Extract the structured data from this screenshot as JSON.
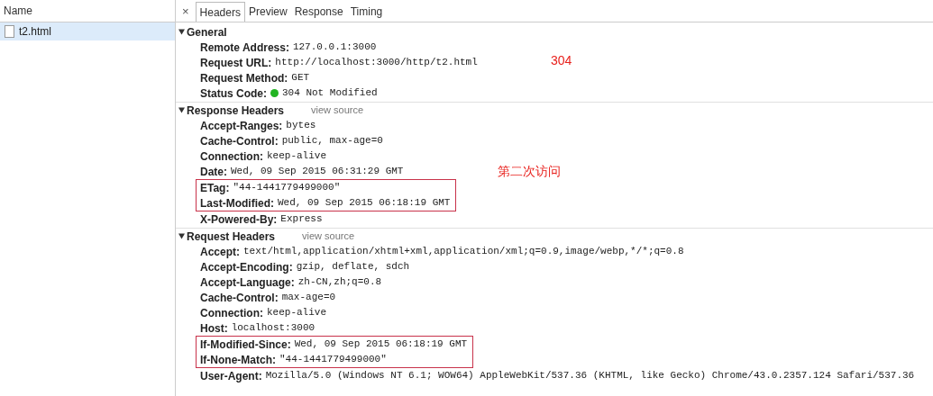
{
  "files": {
    "column": "Name",
    "items": [
      {
        "name": "t2.html",
        "selected": true
      }
    ]
  },
  "tabs": {
    "close": "×",
    "items": [
      {
        "label": "Headers",
        "selected": true
      },
      {
        "label": "Preview",
        "selected": false
      },
      {
        "label": "Response",
        "selected": false
      },
      {
        "label": "Timing",
        "selected": false
      }
    ]
  },
  "sections": [
    {
      "title": "General",
      "expanded": true,
      "note": "304",
      "rows": [
        {
          "key": "Remote Address:",
          "value": "127.0.0.1:3000",
          "highlighted": false
        },
        {
          "key": "Request URL:",
          "value": "http://localhost:3000/http/t2.html",
          "highlighted": false
        },
        {
          "key": "Request Method:",
          "value": "GET",
          "highlighted": false
        },
        {
          "key": "Status Code:",
          "value": "304 Not Modified",
          "highlighted": false,
          "color": "#22b422"
        }
      ]
    },
    {
      "title": "Response Headers",
      "expanded": true,
      "link": "view source",
      "note": "第二次访问",
      "rows": [
        {
          "key": "Accept-Ranges:",
          "value": "bytes",
          "highlighted": false
        },
        {
          "key": "Cache-Control:",
          "value": "public, max-age=0",
          "highlighted": false
        },
        {
          "key": "Connection:",
          "value": "keep-alive",
          "highlighted": false
        },
        {
          "key": "Date:",
          "value": "Wed, 09 Sep 2015 06:31:29 GMT",
          "highlighted": false
        },
        {
          "key": "ETag:",
          "value": "\"44-1441779499000\"",
          "highlighted": true
        },
        {
          "key": "Last-Modified:",
          "value": "Wed, 09 Sep 2015 06:18:19 GMT",
          "highlighted": true
        },
        {
          "key": "X-Powered-By:",
          "value": "Express",
          "highlighted": false
        }
      ]
    },
    {
      "title": "Request Headers",
      "expanded": true,
      "link": "view source",
      "rows": [
        {
          "key": "Accept:",
          "value": "text/html,application/xhtml+xml,application/xml;q=0.9,image/webp,*/*;q=0.8",
          "highlighted": false
        },
        {
          "key": "Accept-Encoding:",
          "value": "gzip, deflate, sdch",
          "highlighted": false
        },
        {
          "key": "Accept-Language:",
          "value": "zh-CN,zh;q=0.8",
          "highlighted": false
        },
        {
          "key": "Cache-Control:",
          "value": "max-age=0",
          "highlighted": false
        },
        {
          "key": "Connection:",
          "value": "keep-alive",
          "highlighted": false
        },
        {
          "key": "Host:",
          "value": "localhost:3000",
          "highlighted": false
        },
        {
          "key": "If-Modified-Since:",
          "value": "Wed, 09 Sep 2015 06:18:19 GMT",
          "highlighted": true
        },
        {
          "key": "If-None-Match:",
          "value": "\"44-1441779499000\"",
          "highlighted": true
        },
        {
          "key": "User-Agent:",
          "value": "Mozilla/5.0 (Windows NT 6.1; WOW64) AppleWebKit/537.36 (KHTML, like Gecko) Chrome/43.0.2357.124 Safari/537.36",
          "highlighted": false
        }
      ]
    }
  ]
}
